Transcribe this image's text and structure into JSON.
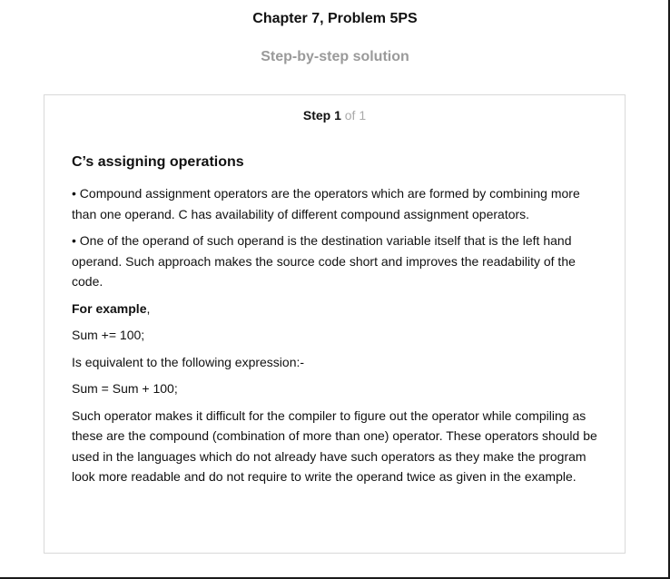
{
  "header": {
    "title": "Chapter 7, Problem 5PS",
    "subtitle": "Step-by-step solution"
  },
  "step": {
    "label": "Step 1",
    "of_text": "of 1"
  },
  "solution": {
    "heading": "C’s assigning operations",
    "bullet1": "• Compound assignment operators are the operators which are formed by combining more than one operand. C has availability of different compound assignment operators.",
    "bullet2": "• One of the operand of such operand is the destination variable itself that is the left hand operand. Such approach makes the source code short and improves the readability of the code.",
    "example_label": "For example",
    "example_suffix": ",",
    "code1": "Sum += 100;",
    "equivalent_text": "Is equivalent to the following expression:-",
    "code2": "Sum = Sum + 100;",
    "closing": "Such operator makes it difficult for the compiler to figure out the operator while compiling as these are the compound (combination of more than one) operator. These operators should be used in the languages which do not already have such operators as they make the program look more readable and do not require to write the operand twice as given in the example."
  }
}
